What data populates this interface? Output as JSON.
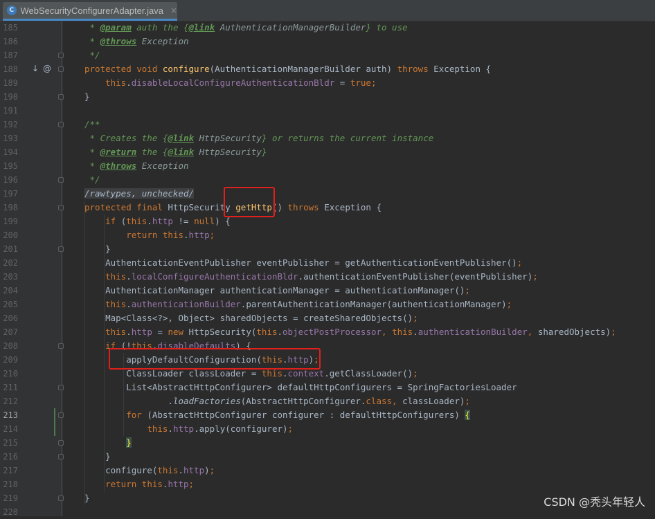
{
  "tab": {
    "filename": "WebSecurityConfigurerAdapter.java",
    "icon": "C",
    "close": "×"
  },
  "watermark": "CSDN @秃头年轻人",
  "lines": [
    {
      "n": "185",
      "code": [
        [
          "cm",
          " * "
        ],
        [
          "tag",
          "@param"
        ],
        [
          "cm",
          " auth the {"
        ],
        [
          "tag",
          "@link"
        ],
        [
          "cmref",
          " AuthenticationManagerBuilder"
        ],
        [
          "cm",
          "} to use"
        ]
      ]
    },
    {
      "n": "186",
      "code": [
        [
          "cm",
          " * "
        ],
        [
          "tag",
          "@throws"
        ],
        [
          "cmref",
          " Exception"
        ]
      ]
    },
    {
      "n": "187",
      "code": [
        [
          "cm",
          " */"
        ]
      ]
    },
    {
      "n": "188",
      "code": [
        [
          "kw",
          "protected void "
        ],
        [
          "fn",
          "configure"
        ],
        [
          "",
          "(AuthenticationManagerBuilder auth) "
        ],
        [
          "kw",
          "throws "
        ],
        [
          "",
          "Exception {"
        ]
      ]
    },
    {
      "n": "189",
      "code": [
        [
          "",
          "    "
        ],
        [
          "kw",
          "this"
        ],
        [
          "",
          "."
        ],
        [
          "field",
          "disableLocalConfigureAuthenticationBldr"
        ],
        [
          "",
          " = "
        ],
        [
          "kw",
          "true"
        ],
        [
          "kw",
          ";"
        ]
      ]
    },
    {
      "n": "190",
      "code": [
        [
          "",
          "}"
        ]
      ]
    },
    {
      "n": "191",
      "code": []
    },
    {
      "n": "192",
      "code": [
        [
          "cm",
          "/**"
        ]
      ]
    },
    {
      "n": "193",
      "code": [
        [
          "cm",
          " * Creates the {"
        ],
        [
          "tag",
          "@link"
        ],
        [
          "cmref",
          " HttpSecurity"
        ],
        [
          "cm",
          "} or returns the current instance"
        ]
      ]
    },
    {
      "n": "194",
      "code": [
        [
          "cm",
          " * "
        ],
        [
          "tag",
          "@return"
        ],
        [
          "cm",
          " the {"
        ],
        [
          "tag",
          "@link"
        ],
        [
          "cmref",
          " HttpSecurity"
        ],
        [
          "cm",
          "}"
        ]
      ]
    },
    {
      "n": "195",
      "code": [
        [
          "cm",
          " * "
        ],
        [
          "tag",
          "@throws"
        ],
        [
          "cmref",
          " Exception"
        ]
      ]
    },
    {
      "n": "196",
      "code": [
        [
          "cm",
          " */"
        ]
      ]
    },
    {
      "n": "197",
      "code": [
        [
          "sup",
          "/rawtypes, unchecked/"
        ]
      ]
    },
    {
      "n": "198",
      "code": [
        [
          "kw",
          "protected final "
        ],
        [
          "",
          "HttpSecurity "
        ],
        [
          "fn",
          "getHttp"
        ],
        [
          "",
          "() "
        ],
        [
          "kw",
          "throws "
        ],
        [
          "",
          "Exception {"
        ]
      ]
    },
    {
      "n": "199",
      "code": [
        [
          "",
          "    "
        ],
        [
          "kw",
          "if "
        ],
        [
          "",
          "("
        ],
        [
          "kw",
          "this"
        ],
        [
          "",
          "."
        ],
        [
          "field",
          "http"
        ],
        [
          "",
          " != "
        ],
        [
          "kw",
          "null"
        ],
        [
          "",
          ") {"
        ]
      ]
    },
    {
      "n": "200",
      "code": [
        [
          "",
          "        "
        ],
        [
          "kw",
          "return this"
        ],
        [
          "",
          "."
        ],
        [
          "field",
          "http"
        ],
        [
          "kw",
          ";"
        ]
      ]
    },
    {
      "n": "201",
      "code": [
        [
          "",
          "    }"
        ]
      ]
    },
    {
      "n": "202",
      "code": [
        [
          "",
          "    AuthenticationEventPublisher eventPublisher = getAuthenticationEventPublisher()"
        ],
        [
          "kw",
          ";"
        ]
      ]
    },
    {
      "n": "203",
      "code": [
        [
          "",
          "    "
        ],
        [
          "kw",
          "this"
        ],
        [
          "",
          "."
        ],
        [
          "field",
          "localConfigureAuthenticationBldr"
        ],
        [
          "",
          ".authenticationEventPublisher(eventPublisher)"
        ],
        [
          "kw",
          ";"
        ]
      ]
    },
    {
      "n": "204",
      "code": [
        [
          "",
          "    AuthenticationManager authenticationManager = authenticationManager()"
        ],
        [
          "kw",
          ";"
        ]
      ]
    },
    {
      "n": "205",
      "code": [
        [
          "",
          "    "
        ],
        [
          "kw",
          "this"
        ],
        [
          "",
          "."
        ],
        [
          "field",
          "authenticationBuilder"
        ],
        [
          "",
          ".parentAuthenticationManager(authenticationManager)"
        ],
        [
          "kw",
          ";"
        ]
      ]
    },
    {
      "n": "206",
      "code": [
        [
          "",
          "    Map<Class<?>, Object> sharedObjects = createSharedObjects()"
        ],
        [
          "kw",
          ";"
        ]
      ]
    },
    {
      "n": "207",
      "code": [
        [
          "",
          "    "
        ],
        [
          "kw",
          "this"
        ],
        [
          "",
          "."
        ],
        [
          "field",
          "http"
        ],
        [
          "",
          " = "
        ],
        [
          "kw",
          "new "
        ],
        [
          "",
          "HttpSecurity("
        ],
        [
          "kw",
          "this"
        ],
        [
          "",
          "."
        ],
        [
          "field",
          "objectPostProcessor"
        ],
        [
          "kw",
          ", this"
        ],
        [
          "",
          "."
        ],
        [
          "field",
          "authenticationBuilder"
        ],
        [
          "kw",
          ", "
        ],
        [
          "",
          "sharedObjects)"
        ],
        [
          "kw",
          ";"
        ]
      ]
    },
    {
      "n": "208",
      "code": [
        [
          "",
          "    "
        ],
        [
          "kw",
          "if "
        ],
        [
          "",
          "(!"
        ],
        [
          "kw",
          "this"
        ],
        [
          "",
          "."
        ],
        [
          "field",
          "disableDefaults"
        ],
        [
          "",
          ") {"
        ]
      ]
    },
    {
      "n": "209",
      "code": [
        [
          "",
          "        applyDefaultConfiguration("
        ],
        [
          "kw",
          "this"
        ],
        [
          "",
          "."
        ],
        [
          "field",
          "http"
        ],
        [
          "",
          ")"
        ],
        [
          "kw",
          ";"
        ]
      ]
    },
    {
      "n": "210",
      "code": [
        [
          "",
          "        ClassLoader classLoader = "
        ],
        [
          "kw",
          "this"
        ],
        [
          "",
          "."
        ],
        [
          "field",
          "context"
        ],
        [
          "",
          ".getClassLoader()"
        ],
        [
          "kw",
          ";"
        ]
      ]
    },
    {
      "n": "211",
      "code": [
        [
          "",
          "        List<AbstractHttpConfigurer> defaultHttpConfigurers = SpringFactoriesLoader"
        ]
      ]
    },
    {
      "n": "212",
      "code": [
        [
          "",
          "                ."
        ],
        [
          "ital",
          "loadFactories"
        ],
        [
          "",
          "(AbstractHttpConfigurer."
        ],
        [
          "kw",
          "class, "
        ],
        [
          "",
          "classLoader)"
        ],
        [
          "kw",
          ";"
        ]
      ]
    },
    {
      "n": "213",
      "code": [
        [
          "",
          "        "
        ],
        [
          "kw",
          "for "
        ],
        [
          "",
          "(AbstractHttpConfigurer configurer : defaultHttpConfigurers) "
        ],
        [
          "brace-hl",
          "{"
        ]
      ]
    },
    {
      "n": "214",
      "code": [
        [
          "",
          "            "
        ],
        [
          "kw",
          "this"
        ],
        [
          "",
          "."
        ],
        [
          "field",
          "http"
        ],
        [
          "",
          ".apply(configurer)"
        ],
        [
          "kw",
          ";"
        ]
      ]
    },
    {
      "n": "215",
      "code": [
        [
          "",
          "        "
        ],
        [
          "brace-hl",
          "}"
        ]
      ]
    },
    {
      "n": "216",
      "code": [
        [
          "",
          "    }"
        ]
      ]
    },
    {
      "n": "217",
      "code": [
        [
          "",
          "    configure("
        ],
        [
          "kw",
          "this"
        ],
        [
          "",
          "."
        ],
        [
          "field",
          "http"
        ],
        [
          "",
          ")"
        ],
        [
          "kw",
          ";"
        ]
      ]
    },
    {
      "n": "218",
      "code": [
        [
          "",
          "    "
        ],
        [
          "kw",
          "return this"
        ],
        [
          "",
          "."
        ],
        [
          "field",
          "http"
        ],
        [
          "kw",
          ";"
        ]
      ]
    },
    {
      "n": "219",
      "code": [
        [
          "",
          "}"
        ]
      ]
    },
    {
      "n": "220",
      "code": []
    }
  ],
  "current_line": "213",
  "gutter_icons": {
    "line": "188",
    "override": "↓",
    "at": "@"
  }
}
